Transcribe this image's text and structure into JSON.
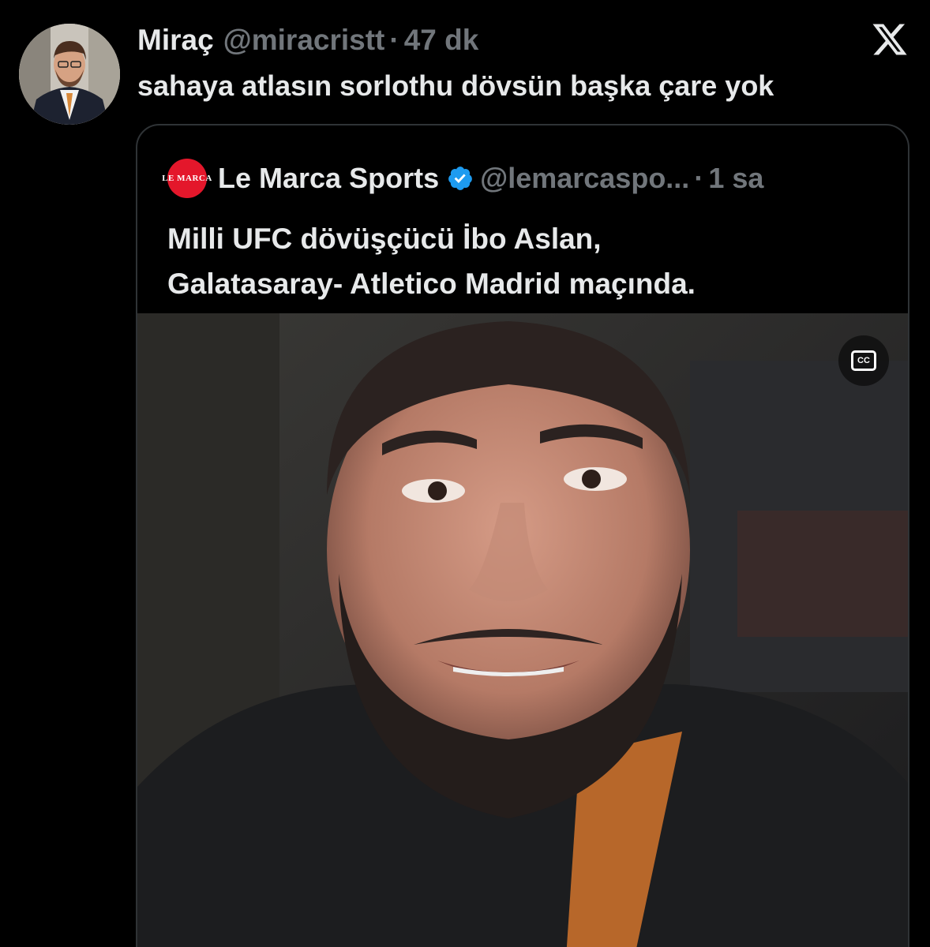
{
  "tweet": {
    "author_name": "Miraç",
    "handle": "@miracristt",
    "separator": "·",
    "time": "47 dk",
    "text": "sahaya atlasın sorlothu dövsün başka çare yok",
    "avatar_icon": "person-avatar-icon"
  },
  "branding": {
    "logo_icon": "x-logo-icon"
  },
  "quoted_tweet": {
    "logo_text": "LE MARCA",
    "author_name": "Le Marca Sports",
    "verified_icon": "verified-badge-icon",
    "handle": "@lemarcaspo...",
    "separator": "·",
    "time": "1 sa",
    "text_line1": "Milli UFC dövüşçücü İbo Aslan,",
    "text_line2": "Galatasaray- Atletico Madrid maçında.",
    "media": {
      "type": "video",
      "cc_label": "CC",
      "cc_icon": "closed-captions-icon"
    }
  },
  "colors": {
    "background": "#000000",
    "text_primary": "#e7e9ea",
    "text_secondary": "#71767b",
    "border": "#2f3336",
    "verified": "#1d9bf0",
    "logo_red": "#e4172b"
  }
}
